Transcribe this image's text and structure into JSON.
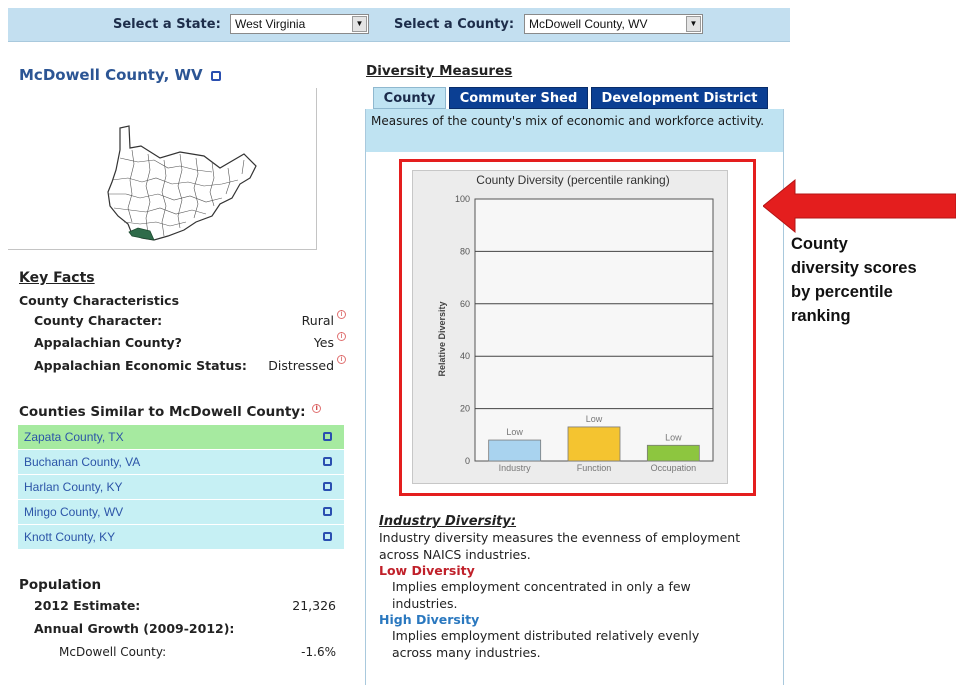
{
  "selector": {
    "state_label": "Select a State:",
    "state_value": "West Virginia",
    "county_label": "Select a County:",
    "county_value": "McDowell County, WV"
  },
  "county_title": "McDowell County, WV",
  "key_facts": {
    "heading": "Key Facts",
    "characteristics_heading": "County Characteristics",
    "rows": [
      {
        "label": "County Character:",
        "value": "Rural"
      },
      {
        "label": "Appalachian County?",
        "value": "Yes"
      },
      {
        "label": "Appalachian Economic Status:",
        "value": "Distressed"
      }
    ]
  },
  "similar": {
    "heading": "Counties Similar to McDowell County:",
    "items": [
      "Zapata County, TX",
      "Buchanan County, VA",
      "Harlan County, KY",
      "Mingo County, WV",
      "Knott County, KY"
    ]
  },
  "population": {
    "heading": "Population",
    "estimate_label": "2012 Estimate:",
    "estimate_value": "21,326",
    "growth_label": "Annual Growth (2009-2012):",
    "county_label": "McDowell County:",
    "county_value": "-1.6%"
  },
  "diversity": {
    "title": "Diversity Measures",
    "tabs": [
      "County",
      "Commuter Shed",
      "Development District"
    ],
    "description": "Measures of the county's mix of economic and workforce activity."
  },
  "chart_data": {
    "type": "bar",
    "title": "County Diversity (percentile ranking)",
    "ylabel": "Relative Diversity",
    "xlabel": "",
    "categories": [
      "Industry",
      "Function",
      "Occupation"
    ],
    "values": [
      8,
      13,
      6
    ],
    "bar_labels": [
      "Low",
      "Low",
      "Low"
    ],
    "bar_colors": [
      "#a9d3ef",
      "#f4c430",
      "#8dc63f"
    ],
    "ylim": [
      0,
      100
    ],
    "yticks": [
      0,
      20,
      40,
      60,
      80,
      100
    ],
    "grid": true
  },
  "industry_diversity": {
    "heading": "Industry Diversity:",
    "text": [
      "Industry diversity measures the evenness of employment",
      "across NAICS industries."
    ],
    "low_heading": "Low Diversity",
    "low_text": [
      "Implies employment concentrated in only a few",
      "industries."
    ],
    "high_heading": "High Diversity",
    "high_text": [
      "Implies employment distributed relatively evenly",
      "across many industries."
    ]
  },
  "callout": {
    "lines": [
      "County",
      "diversity scores",
      "by percentile",
      "ranking"
    ],
    "arrow_color": "#e41e1e"
  },
  "colors": {
    "accent_blue": "#0b3f93",
    "tab_active": "#bfe3f2",
    "similar_first": "#a6eaa0",
    "similar_rest": "#c6f0f4",
    "highlight_red": "#e41e1e",
    "map_highlight": "#2f6b4a"
  }
}
